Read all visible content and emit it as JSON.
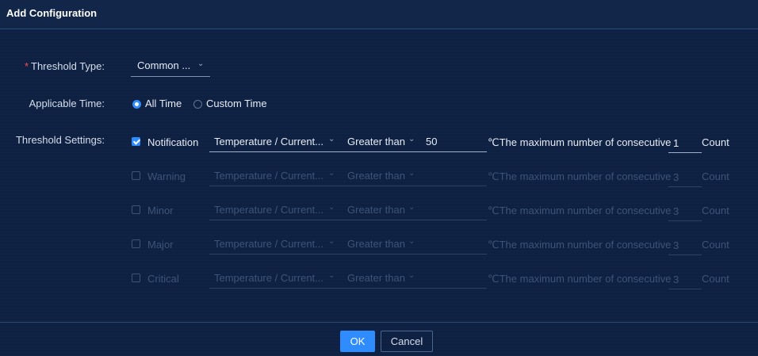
{
  "dialog": {
    "title": "Add Configuration"
  },
  "form": {
    "threshold_type": {
      "required_mark": "*",
      "label": "Threshold Type:",
      "value": "Common ..."
    },
    "applicable_time": {
      "label": "Applicable Time:",
      "options": [
        {
          "label": "All Time",
          "selected": true
        },
        {
          "label": "Custom Time",
          "selected": false
        }
      ]
    },
    "threshold_settings": {
      "label": "Threshold Settings:",
      "rows": [
        {
          "level": "Notification",
          "checked": true,
          "metric": "Temperature / Current...",
          "comparator": "Greater than",
          "value": "50",
          "description": "℃The maximum number of consecutive",
          "count": "1",
          "unit": "Count"
        },
        {
          "level": "Warning",
          "checked": false,
          "metric": "Temperature / Current...",
          "comparator": "Greater than",
          "value": "",
          "description": "℃The maximum number of consecutive",
          "count": "3",
          "unit": "Count"
        },
        {
          "level": "Minor",
          "checked": false,
          "metric": "Temperature / Current...",
          "comparator": "Greater than",
          "value": "",
          "description": "℃The maximum number of consecutive",
          "count": "3",
          "unit": "Count"
        },
        {
          "level": "Major",
          "checked": false,
          "metric": "Temperature / Current...",
          "comparator": "Greater than",
          "value": "",
          "description": "℃The maximum number of consecutive",
          "count": "3",
          "unit": "Count"
        },
        {
          "level": "Critical",
          "checked": false,
          "metric": "Temperature / Current...",
          "comparator": "Greater than",
          "value": "",
          "description": "℃The maximum number of consecutive",
          "count": "3",
          "unit": "Count"
        }
      ]
    }
  },
  "footer": {
    "ok_label": "OK",
    "cancel_label": "Cancel"
  },
  "icons": {
    "dropdown": "chevron-down-icon"
  },
  "colors": {
    "background": "#0f2143",
    "accent": "#2f8cff",
    "required": "#ff4d4f",
    "disabled_text": "#3d5478"
  }
}
